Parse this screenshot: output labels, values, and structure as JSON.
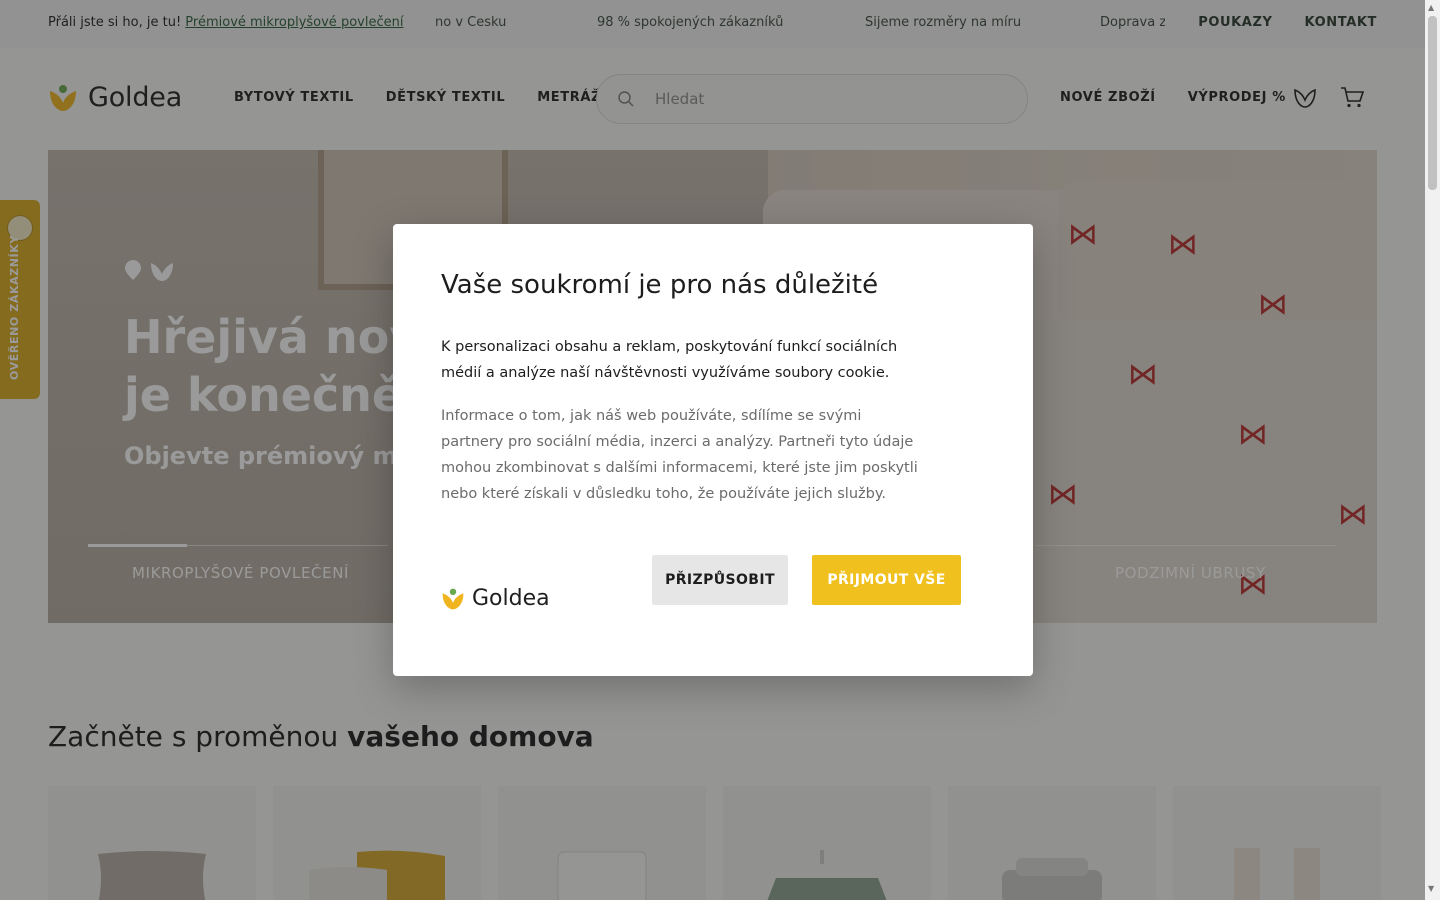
{
  "topbar": {
    "promo_text": "Přáli jste si ho, je tu! ",
    "promo_link": "Prémiové mikroplyšové povlečení",
    "ticker": [
      "no v Česku",
      "98 % spokojených zákazníků",
      "Šijeme rozměry na míru",
      "Doprava z"
    ],
    "links": [
      "POUKAZY",
      "KONTAKT"
    ]
  },
  "header": {
    "logo_text": "Goldea",
    "nav": [
      "BYTOVÝ TEXTIL",
      "DĚTSKÝ TEXTIL",
      "METRÁŽE"
    ],
    "search_placeholder": "Hledat",
    "right_nav": [
      "NOVÉ ZBOŽÍ",
      "VÝPRODEJ %"
    ],
    "icons": [
      "search-icon",
      "wishlist-icon",
      "cart-icon"
    ]
  },
  "verified_tab": {
    "label": "OVĚŘENO ZÁKAZNÍKY"
  },
  "hero": {
    "heading_line1": "Hřejivá novi",
    "heading_line2": "je konečně t",
    "subheading": "Objevte prémiový mikr",
    "tabs": [
      "MIKROPLYŠOVÉ POVLEČENÍ",
      "PODZIMNÍ UBRUSY"
    ]
  },
  "section": {
    "title_regular": "Začněte s proměnou ",
    "title_bold": "vašeho domova",
    "cards": [
      "pillow",
      "cushions",
      "fitted-sheet",
      "tablecloth",
      "towels",
      "curtains"
    ]
  },
  "cookie_modal": {
    "title": "Vaše soukromí je pro nás důležité",
    "paragraph1": "K personalizaci obsahu a reklam, poskytování funkcí sociálních médií a analýze naší návštěvnosti využíváme soubory cookie.",
    "paragraph2": "Informace o tom, jak náš web používáte, sdílíme se svými partnery pro sociální média, inzerci a analýzy. Partneři tyto údaje mohou zkombinovat s dalšími informacemi, které jste jim poskytli nebo které získali v důsledku toho, že používáte jejich služby.",
    "logo_text": "Goldea",
    "customize_label": "PŘIZPŮSOBIT",
    "accept_label": "PŘIJMOUT VŠE"
  },
  "colors": {
    "accent_yellow": "#f0c11e",
    "brand_green": "#2a5e3a",
    "topbar_bg": "#eef1ee"
  }
}
